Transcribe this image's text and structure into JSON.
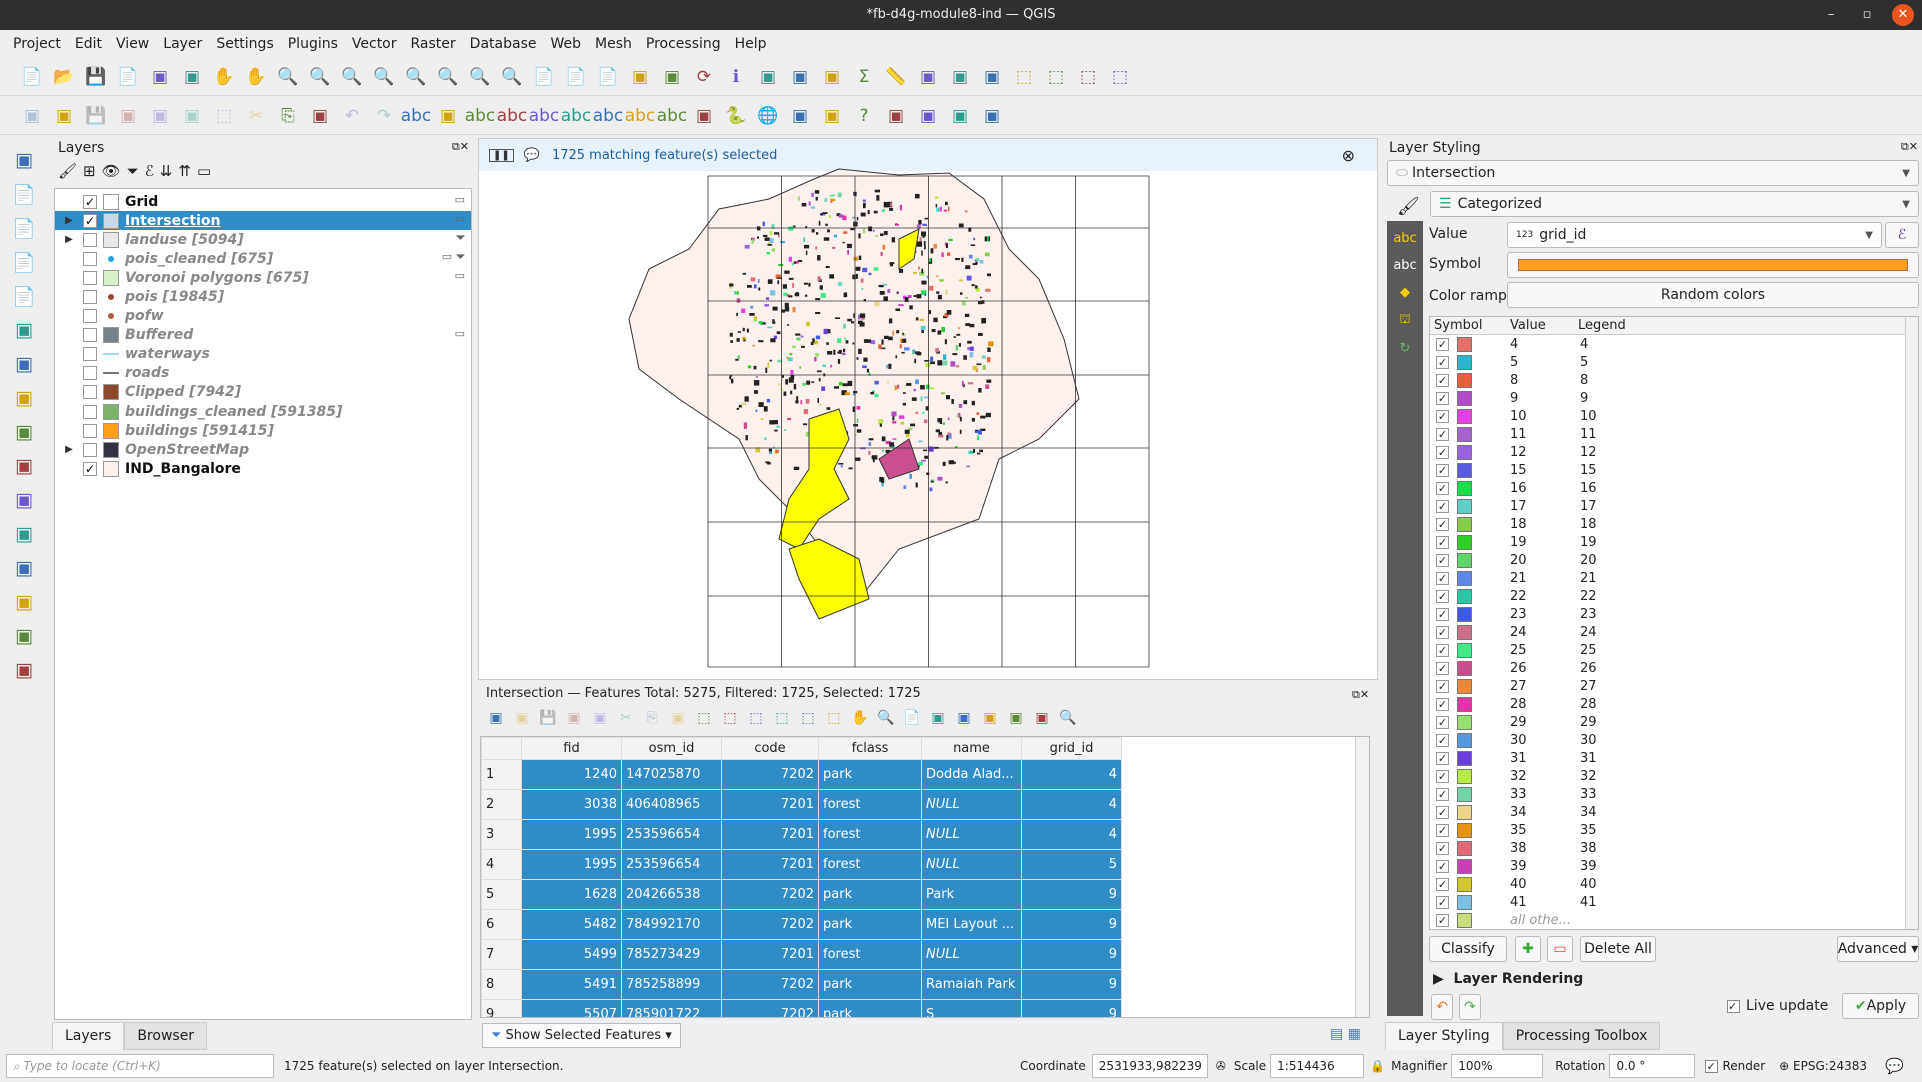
{
  "window": {
    "title": "*fb-d4g-module8-ind — QGIS"
  },
  "menu": [
    "Project",
    "Edit",
    "View",
    "Layer",
    "Settings",
    "Plugins",
    "Vector",
    "Raster",
    "Database",
    "Web",
    "Mesh",
    "Processing",
    "Help"
  ],
  "toolbar1": [
    "new-project-icon",
    "open-project-icon",
    "save-project-icon",
    "new-print-layout-icon",
    "layout-manager-icon",
    "style-manager-icon",
    "pan-icon",
    "pan-to-selection-icon",
    "zoom-in-icon",
    "zoom-out-icon",
    "zoom-full-icon",
    "zoom-to-selection-icon",
    "zoom-to-layer-icon",
    "zoom-native-icon",
    "zoom-last-icon",
    "zoom-next-icon",
    "new-map-view-icon",
    "new-3d-view-icon",
    "new-bookmark-icon",
    "show-bookmarks-icon",
    "temporal-controller-icon",
    "refresh-icon",
    "identify-icon",
    "attribute-table-icon",
    "field-calculator-icon",
    "processing-toolbox-icon",
    "statistics-icon",
    "measure-icon",
    "map-tips-icon",
    "annotation-icon",
    "text-annotation-icon",
    "select-features-icon",
    "select-by-expression-icon",
    "deselect-icon",
    "select-location-icon"
  ],
  "toolbar2": [
    "current-edits-icon",
    "toggle-editing-icon",
    "save-edits-icon",
    "digitize-icon",
    "vertex-tool-icon",
    "modify-attributes-icon",
    "delete-selected-icon",
    "cut-icon",
    "copy-icon",
    "paste-icon",
    "undo-icon",
    "redo-icon",
    "label-icon",
    "diagram-icon",
    "pin-labels-icon",
    "highlight-labels-icon",
    "show-hide-labels-icon",
    "move-label-icon",
    "rotate-label-icon",
    "change-label-icon",
    "label-props-icon",
    "osm-download-icon",
    "python-console-icon",
    "globe-icon",
    "metasearch-icon",
    "georeferencer-icon",
    "help-icon",
    "plugin-a-icon",
    "plugin-b-icon",
    "search-plugin-icon",
    "plugin-c-icon"
  ],
  "left_tools": [
    "data-source-manager-icon",
    "new-geopackage-icon",
    "new-shapefile-icon",
    "new-temp-layer-icon",
    "new-virtual-layer-icon",
    "add-vector-icon",
    "add-raster-icon",
    "add-mesh-icon",
    "add-delimited-text-icon",
    "add-spatialite-icon",
    "add-virtual-layer-icon",
    "add-postgis-icon",
    "add-wms-icon",
    "add-wfs-icon",
    "add-wcs-icon",
    "add-xyz-icon"
  ],
  "layers": {
    "title": "Layers",
    "items": [
      {
        "name": "Grid",
        "checked": true,
        "color": "#ffffff",
        "indicators": [
          "memory-icon"
        ]
      },
      {
        "name": "Intersection",
        "checked": true,
        "selected": true,
        "expandable": true,
        "color": "#c9d9e8",
        "indicators": [
          "memory-icon"
        ]
      },
      {
        "name": "landuse [5094]",
        "checked": false,
        "expandable": true,
        "color": "#e8e8e8",
        "indicators": [
          "filter-icon"
        ]
      },
      {
        "name": "pois_cleaned [675]",
        "checked": false,
        "color": "#2a9ee0",
        "point": true,
        "indicators": [
          "memory-icon",
          "filter-icon"
        ]
      },
      {
        "name": "Voronoi polygons [675]",
        "checked": false,
        "color": "#d7f0c8",
        "indicators": [
          "memory-icon"
        ]
      },
      {
        "name": "pois [19845]",
        "checked": false,
        "color": "#a0463c",
        "point": true,
        "indicators": []
      },
      {
        "name": "pofw",
        "checked": false,
        "color": "#b05a3c",
        "point": true,
        "indicators": []
      },
      {
        "name": "Buffered",
        "checked": false,
        "color": "#768489",
        "indicators": [
          "memory-icon"
        ]
      },
      {
        "name": "waterways",
        "checked": false,
        "color": "#9fd8f0",
        "line": true,
        "indicators": []
      },
      {
        "name": "roads",
        "checked": false,
        "color": "#777777",
        "line": true,
        "indicators": []
      },
      {
        "name": "Clipped [7942]",
        "checked": false,
        "color": "#8b4a2b",
        "indicators": []
      },
      {
        "name": "buildings_cleaned [591385]",
        "checked": false,
        "color": "#7cb26a",
        "indicators": []
      },
      {
        "name": "buildings [591415]",
        "checked": false,
        "color": "#ff9f1c",
        "indicators": []
      },
      {
        "name": "OpenStreetMap",
        "checked": false,
        "expandable": true,
        "color": "#334",
        "indicators": []
      },
      {
        "name": "IND_Bangalore",
        "checked": true,
        "color": "#fdf1ee",
        "indicators": []
      }
    ],
    "tabs": [
      "Layers",
      "Browser"
    ]
  },
  "map": {
    "selection_message": "1725 matching feature(s) selected"
  },
  "attribute_table": {
    "title": "Intersection — Features Total: 5275, Filtered: 1725, Selected: 1725",
    "columns": [
      "fid",
      "osm_id",
      "code",
      "fclass",
      "name",
      "grid_id"
    ],
    "rows": [
      [
        "1",
        "1240",
        "147025870",
        "7202",
        "park",
        "Dodda Alad...",
        "4"
      ],
      [
        "2",
        "3038",
        "406408965",
        "7201",
        "forest",
        "NULL",
        "4"
      ],
      [
        "3",
        "1995",
        "253596654",
        "7201",
        "forest",
        "NULL",
        "4"
      ],
      [
        "4",
        "1995",
        "253596654",
        "7201",
        "forest",
        "NULL",
        "5"
      ],
      [
        "5",
        "1628",
        "204266538",
        "7202",
        "park",
        "Park",
        "9"
      ],
      [
        "6",
        "5482",
        "784992170",
        "7202",
        "park",
        "MEI Layout ...",
        "9"
      ],
      [
        "7",
        "5499",
        "785273429",
        "7201",
        "forest",
        "NULL",
        "9"
      ],
      [
        "8",
        "5491",
        "785258899",
        "7202",
        "park",
        "Ramaiah Park",
        "9"
      ],
      [
        "9",
        "5507",
        "785901722",
        "7202",
        "park",
        "S",
        "9"
      ]
    ],
    "show_features": "Show Selected Features"
  },
  "styling": {
    "title": "Layer Styling",
    "layer": "Intersection",
    "renderer": "Categorized",
    "value_label": "Value",
    "value": "grid_id",
    "value_type": "123",
    "symbol_label": "Symbol",
    "symbol_color": "#ff9f1c",
    "ramp_label": "Color ramp",
    "ramp": "Random colors",
    "legend_headers": [
      "Symbol",
      "Value",
      "Legend"
    ],
    "categories": [
      [
        "4",
        "#e5706a"
      ],
      [
        "5",
        "#2bb3cf"
      ],
      [
        "8",
        "#e8603a"
      ],
      [
        "9",
        "#b04cc8"
      ],
      [
        "10",
        "#ec3ee6"
      ],
      [
        "11",
        "#a463cf"
      ],
      [
        "12",
        "#9a62e2"
      ],
      [
        "15",
        "#5b5be0"
      ],
      [
        "16",
        "#13e14a"
      ],
      [
        "17",
        "#5ecfc8"
      ],
      [
        "18",
        "#8acb4c"
      ],
      [
        "19",
        "#2fcf24"
      ],
      [
        "20",
        "#5cd46a"
      ],
      [
        "21",
        "#5f86ea"
      ],
      [
        "22",
        "#27c8a6"
      ],
      [
        "23",
        "#3f58e6"
      ],
      [
        "24",
        "#cc6e8a"
      ],
      [
        "25",
        "#40ea86"
      ],
      [
        "26",
        "#c94f8e"
      ],
      [
        "27",
        "#ec8638"
      ],
      [
        "28",
        "#e230a5"
      ],
      [
        "29",
        "#98e070"
      ],
      [
        "30",
        "#5598e0"
      ],
      [
        "31",
        "#6a3fd8"
      ],
      [
        "32",
        "#b8ec44"
      ],
      [
        "33",
        "#72d4a8"
      ],
      [
        "34",
        "#ecd488"
      ],
      [
        "35",
        "#e8920e"
      ],
      [
        "38",
        "#e06a78"
      ],
      [
        "39",
        "#cc3db8"
      ],
      [
        "40",
        "#d2c82c"
      ],
      [
        "41",
        "#7cc0e4"
      ]
    ],
    "all_other": "all othe...",
    "all_other_color": "#c8dc7c",
    "classify": "Classify",
    "delete_all": "Delete All",
    "advanced": "Advanced",
    "layer_rendering": "Layer Rendering",
    "live_update": "Live update",
    "apply": "Apply",
    "tabs": [
      "Layer Styling",
      "Processing Toolbox"
    ]
  },
  "status": {
    "locate_placeholder": "Type to locate (Ctrl+K)",
    "message": "1725 feature(s) selected on layer Intersection.",
    "coordinate_label": "Coordinate",
    "coordinate": "2531933,982239",
    "scale_label": "Scale",
    "scale": "1:514436",
    "magnifier_label": "Magnifier",
    "magnifier": "100%",
    "rotation_label": "Rotation",
    "rotation": "0.0 °",
    "render_label": "Render",
    "crs": "EPSG:24383"
  }
}
